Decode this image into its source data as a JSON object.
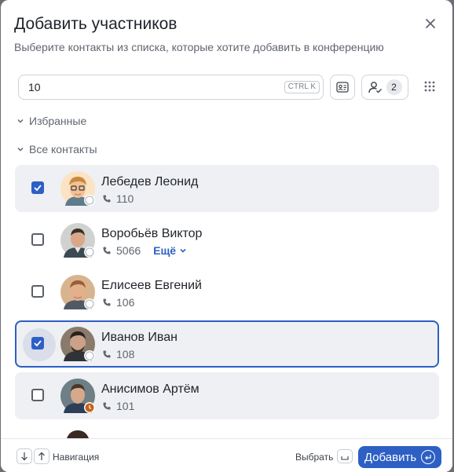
{
  "dialog": {
    "title": "Добавить участников",
    "subtitle": "Выберите контакты из списка, которые хотите добавить в конференцию"
  },
  "search": {
    "value": "10",
    "shortcut": "CTRL K"
  },
  "selected_count": "2",
  "groups": {
    "favorites": "Избранные",
    "all_contacts": "Все контакты"
  },
  "contacts": [
    {
      "name": "Лебедев Леонид",
      "phone": "110",
      "checked": true,
      "status": "offline"
    },
    {
      "name": "Воробьёв Виктор",
      "phone": "5066",
      "more": "Ещё",
      "checked": false,
      "status": "offline"
    },
    {
      "name": "Елисеев Евгений",
      "phone": "106",
      "checked": false,
      "status": "offline"
    },
    {
      "name": "Иванов Иван",
      "phone": "108",
      "checked": true,
      "status": "offline"
    },
    {
      "name": "Анисимов Артём",
      "phone": "101",
      "checked": false,
      "status": "away"
    }
  ],
  "footer": {
    "navigation_label": "Навигация",
    "select_label": "Выбрать",
    "add_button": "Добавить"
  },
  "colors": {
    "accent": "#2d5fc4",
    "away": "#c8621a"
  }
}
